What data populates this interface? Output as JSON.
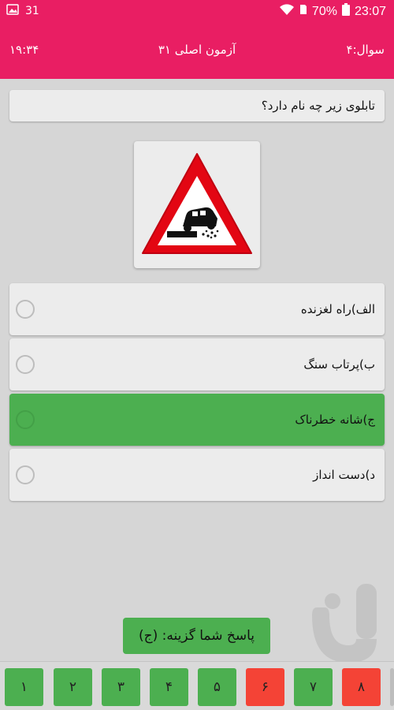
{
  "status_bar": {
    "notification_count": "31",
    "battery": "70%",
    "time": "23:07"
  },
  "header": {
    "timer": "۱۹:۳۴",
    "title": "آزمون اصلی ۳۱",
    "question_number": "سوال:۴"
  },
  "question": {
    "text": "تابلوی زیر چه نام دارد؟",
    "sign_icon": "soft-shoulder-warning-sign"
  },
  "options": [
    {
      "label": "الف)راه لغزنده",
      "selected": false
    },
    {
      "label": "ب)پرتاب سنگ",
      "selected": false
    },
    {
      "label": "ج)شانه خطرناک",
      "selected": true
    },
    {
      "label": "د)دست انداز",
      "selected": false
    }
  ],
  "answer": {
    "text": "پاسخ شما گزینه: (ج)"
  },
  "question_nav": [
    {
      "label": "۱",
      "state": "green"
    },
    {
      "label": "۲",
      "state": "green"
    },
    {
      "label": "۳",
      "state": "green"
    },
    {
      "label": "۴",
      "state": "green"
    },
    {
      "label": "۵",
      "state": "green"
    },
    {
      "label": "۶",
      "state": "red"
    },
    {
      "label": "۷",
      "state": "green"
    },
    {
      "label": "۸",
      "state": "red"
    }
  ],
  "colors": {
    "primary": "#e91e63",
    "correct": "#4caf50",
    "wrong": "#f44336",
    "background": "#d6d6d6"
  }
}
